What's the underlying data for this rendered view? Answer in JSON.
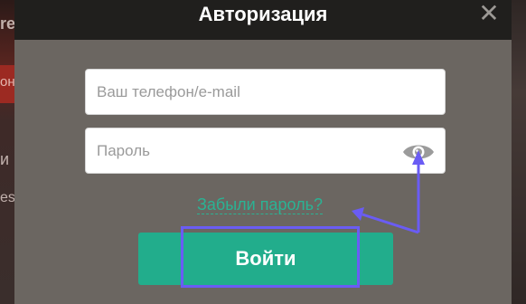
{
  "background": {
    "fragments": [
      "re",
      "он",
      "и",
      "es"
    ]
  },
  "modal": {
    "title": "Авторизация",
    "close_icon": "close-icon"
  },
  "form": {
    "phone_placeholder": "Ваш телефон/e-mail",
    "password_placeholder": "Пароль",
    "show_password_icon": "eye-icon",
    "forgot_password_label": "Забыли пароль?",
    "login_label": "Войти"
  },
  "annotations": {
    "color": "#6a5cf4"
  },
  "colors": {
    "accent": "#22ad8c",
    "link": "#2ab394",
    "header": "#201f1d",
    "modal_bg": "#6b6661"
  }
}
